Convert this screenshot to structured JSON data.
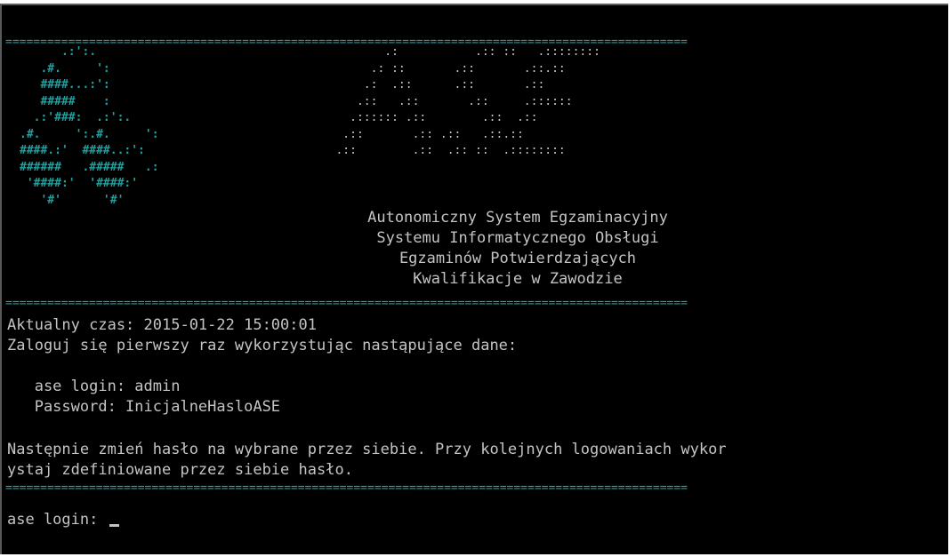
{
  "separator": "==================================================================================================",
  "logo_art": "      .:':.\n   .#.     ':\n   ####...:':\n   #####    :\n  .:'###:  .:':.\n.#.     ':.#.     ':\n####.:'  ####..:':\n######   .#####   .:\n '####:'  '####:'\n   '#'      '#'",
  "ase_art": "          .:           .:: ::   .::::::::\n        .: ::       .::       .::.::\n       .:  .::      .::       .::\n      .::   .::       .::     .::::::\n     .:::::: .::        .::  .::\n    .::       .:: .::   .::.::\n   .::        .::  .:: ::  .::::::::",
  "banner": {
    "line1": "Autonomiczny System Egzaminacyjny",
    "line2": "Systemu Informatycznego Obsługi",
    "line3": "Egzaminów Potwierdzających",
    "line4": "Kwalifikacje w Zawodzie"
  },
  "info": {
    "time_line": "Aktualny czas: 2015-01-22 15:00:01",
    "login_hint": "Zaloguj się pierwszy raz wykorzystując nastąpujące dane:",
    "login_cred": "   ase login: admin",
    "password_cred": "   Password: InicjalneHasloASE",
    "change_line1": "Następnie zmień hasło na wybrane przez siebie. Przy kolejnych logowaniach wykor",
    "change_line2": "ystaj zdefiniowane przez siebie hasło."
  },
  "prompt": {
    "label": "ase login: "
  }
}
